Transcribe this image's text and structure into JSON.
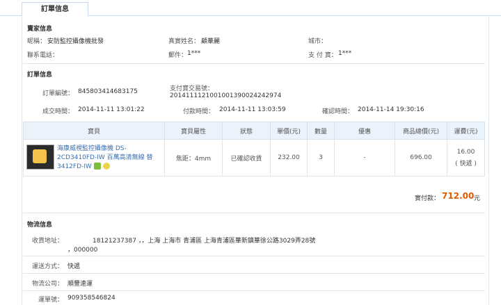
{
  "tab": {
    "label": "訂單信息"
  },
  "seller": {
    "title": "賣家信息",
    "nickname_label": "昵稱：",
    "nickname": "安防監控攝像機批發",
    "realname_label": "真實姓名：",
    "realname": "顧華麗",
    "city_label": "城市：",
    "city": "",
    "phone_label": "聯系電話：",
    "phone": "",
    "email_label": "郵件：",
    "email": "1***",
    "alipay_label": "支 付 寶：",
    "alipay": "1***"
  },
  "order": {
    "title": "訂單信息",
    "number_label": "訂單編號：",
    "number": "845803414683175",
    "trade_label": "支付寶交易號：",
    "trade": "2014111121001001390024242974",
    "deal_label": "成交時間：",
    "deal": "2014-11-11 13:01:22",
    "pay_label": "付款時間：",
    "pay": "2014-11-11 13:03:59",
    "confirm_label": "確認時間：",
    "confirm": "2014-11-14 19:30:16"
  },
  "table": {
    "headers": [
      "寶貝",
      "寶貝屬性",
      "狀態",
      "單價(元)",
      "數量",
      "優惠",
      "商品總價(元)",
      "運費(元)"
    ],
    "row": {
      "name": "海康威視監控攝像機 DS-2CD3410FD-IW 百萬高清無線 替3412FD-IW",
      "attr": "焦距：4mm",
      "status": "已確認收貨",
      "price": "232.00",
      "qty": "3",
      "discount": "-",
      "total": "696.00",
      "shipping": "16.00",
      "shipping_type": "( 快遞 )"
    }
  },
  "paid": {
    "label": "實付款：",
    "value": "712.00",
    "unit": "元"
  },
  "logistics": {
    "title": "物流信息",
    "address_label": "收貨地址：",
    "address_line1": "18121237387 ，，上海 上海市 青浦區 上海青浦區華新鎮華徐公路3029弄28號",
    "address_line2": "，000000",
    "method_label": "運送方式：",
    "method": "快遞",
    "company_label": "物流公司：",
    "company": "順豐速運",
    "waybill_label": "運單號：",
    "waybill": "909358546824"
  },
  "colors": {
    "accent_price": "#e05a00",
    "link": "#3a6fb0",
    "table_header_bg": "#eaf2fb"
  }
}
